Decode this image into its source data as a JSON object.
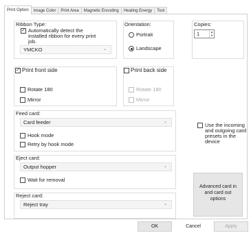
{
  "tabs": [
    "Print Option",
    "Image Color",
    "Print Area",
    "Magnetic Encoding",
    "Heating Energy",
    "Tool"
  ],
  "ribbon": {
    "label": "Ribbon Type:",
    "auto_detect_line1": "Automatically detect the",
    "auto_detect_line2": "installed ribbon for every print",
    "auto_detect_line3": "job.",
    "auto_detect_checked": true,
    "selected": "YMCKO"
  },
  "orientation": {
    "label": "Orientation:",
    "portrait": "Portrait",
    "landscape": "Landscape",
    "selected": "Landscape"
  },
  "copies": {
    "label": "Copies:",
    "value": "1"
  },
  "front": {
    "label": "Print front side",
    "checked": true,
    "rotate": "Rotate 180",
    "mirror": "Mirror"
  },
  "back": {
    "label": "Print back side",
    "checked": false,
    "rotate": "Rotate 180",
    "mirror": "Mirror"
  },
  "feed": {
    "label": "Feed card:",
    "selected": "Card feeder",
    "hook": "Hook mode",
    "retry": "Retry by hook mode"
  },
  "use_presets": {
    "line1": "Use the incoming",
    "line2": "and outgoing card",
    "line3": "presets in the",
    "line4": "device"
  },
  "eject": {
    "label": "Eject card:",
    "selected": "Output hopper",
    "wait": "Wait for removal"
  },
  "advanced": {
    "line1": "Advanced card in",
    "line2": "and card out",
    "line3": "options"
  },
  "reject": {
    "label": "Reject card:",
    "selected": "Reject tray"
  },
  "footer": {
    "ok": "OK",
    "cancel": "Cancel",
    "apply": "Apply"
  },
  "icons": {
    "check": "✓",
    "dropdown": "⌄"
  }
}
